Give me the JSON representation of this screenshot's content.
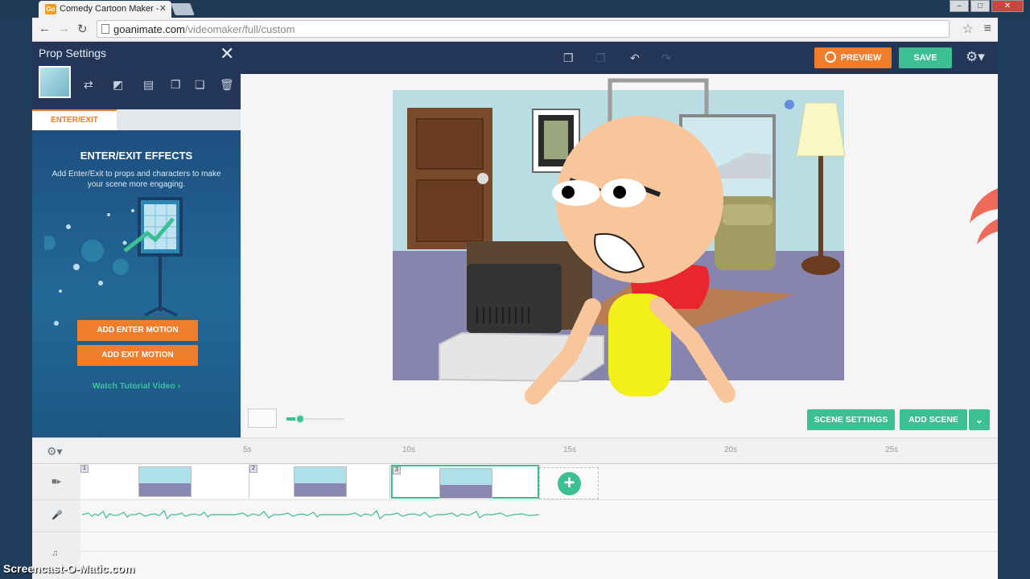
{
  "browser": {
    "tab_title": "Comedy Cartoon Maker -",
    "tab_favicon": "Go",
    "url_domain": "goanimate.com",
    "url_path": "/videomaker/full/custom"
  },
  "toolbar": {
    "preview_label": "PREVIEW",
    "save_label": "SAVE"
  },
  "panel": {
    "title": "Prop Settings",
    "tab_label": "ENTER/EXIT",
    "effects_title": "ENTER/EXIT EFFECTS",
    "effects_desc": "Add Enter/Exit to props and characters to make your scene more engaging.",
    "add_enter_label": "ADD ENTER MOTION",
    "add_exit_label": "ADD EXIT MOTION",
    "tutorial_label": "Watch Tutorial Video ›"
  },
  "stage_controls": {
    "scene_settings_label": "SCENE SETTINGS",
    "add_scene_label": "ADD SCENE",
    "zoom_level": 0.25
  },
  "timeline": {
    "ticks": [
      "5s",
      "10s",
      "15s",
      "20s",
      "25s"
    ],
    "scenes": [
      {
        "number": "1"
      },
      {
        "number": "2"
      },
      {
        "number": "3"
      }
    ]
  },
  "watermark": "Screencast-O-Matic.com",
  "colors": {
    "accent_orange": "#ef7d2c",
    "accent_green": "#3dbf94",
    "topbar": "#243658"
  }
}
